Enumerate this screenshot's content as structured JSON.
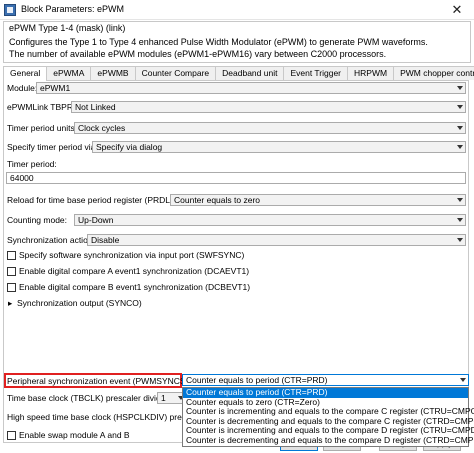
{
  "window": {
    "title": "Block Parameters: ePWM",
    "close_glyph": "✕"
  },
  "header": {
    "group_title": "ePWM Type 1-4 (mask) (link)",
    "description": "Configures the Type 1 to Type 4 enhanced Pulse Width Modulator (ePWM) to generate PWM waveforms.\nThe number of available ePWM modules (ePWM1-ePWM16) vary between C2000 processors."
  },
  "tabs": [
    {
      "label": "General"
    },
    {
      "label": "ePWMA"
    },
    {
      "label": "ePWMB"
    },
    {
      "label": "Counter Compare"
    },
    {
      "label": "Deadband unit"
    },
    {
      "label": "Event Trigger"
    },
    {
      "label": "HRPWM"
    },
    {
      "label": "PWM chopper control"
    }
  ],
  "form": {
    "module_label": "Module:",
    "module_value": "ePWM1",
    "link_label": "ePWMLink TBPRD",
    "link_value": "Not Linked",
    "units_label": "Timer period units:",
    "units_value": "Clock cycles",
    "specify_label": "Specify timer period via:",
    "specify_value": "Specify via dialog",
    "period_label": "Timer period:",
    "period_value": "64000",
    "reload_label": "Reload for time base period register (PRDLD):",
    "reload_value": "Counter equals to zero",
    "mode_label": "Counting mode:",
    "mode_value": "Up-Down",
    "sync_action_label": "Synchronization action:",
    "sync_action_value": "Disable",
    "cb_swfsync": "Specify software synchronization via input port (SWFSYNC)",
    "cb_dcaevt1": "Enable digital compare A event1 synchronization (DCAEVT1)",
    "cb_dcbevt1": "Enable digital compare B event1 synchronization (DCBEVT1)",
    "syncout_label": "Synchronization output (SYNCO)",
    "pws_label": "Peripheral synchronization event (PWMSYNCSEL):",
    "pws_value": "Counter equals to period (CTR=PRD)",
    "tbclk_label": "Time base clock (TBCLK) prescaler divider:",
    "tbclk_value": "1",
    "hsp_label": "High speed time base clock (HSPCLKDIV) prescaler divider:",
    "swap_label": "Enable swap module A and B"
  },
  "dropdown": [
    "Counter equals to period (CTR=PRD)",
    "Counter equals to zero (CTR=Zero)",
    "Counter is incrementing and equals to the compare C register (CTRU=CMPC)",
    "Counter is decrementing and equals to the compare C register (CTRD=CMPC)",
    "Counter is incrementing and equals to the compare D register (CTRU=CMPD)",
    "Counter is decrementing and equals to the compare D register (CTRD=CMPD)"
  ],
  "buttons": {
    "ok": "OK",
    "cancel": "Cancel",
    "help": "Help",
    "apply": "Apply"
  },
  "colors": {
    "highlight_box": "#e02020",
    "selection": "#0078d7"
  }
}
